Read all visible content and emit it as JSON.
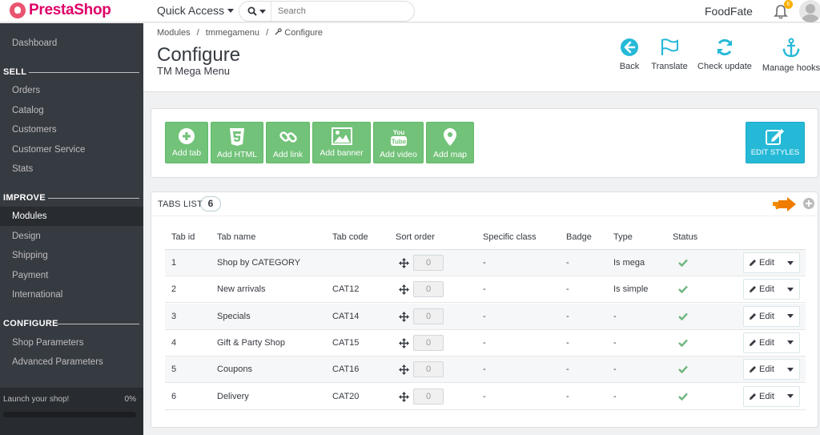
{
  "header": {
    "logo_text": "PrestaShop",
    "quick_access": "Quick Access",
    "search_placeholder": "Search",
    "shop_name": "FoodFate",
    "notification_count": "6"
  },
  "sidebar": {
    "items": [
      {
        "label": "Dashboard"
      },
      {
        "label": "Orders"
      },
      {
        "label": "Catalog"
      },
      {
        "label": "Customers"
      },
      {
        "label": "Customer Service"
      },
      {
        "label": "Stats"
      },
      {
        "label": "Modules"
      },
      {
        "label": "Design"
      },
      {
        "label": "Shipping"
      },
      {
        "label": "Payment"
      },
      {
        "label": "International"
      },
      {
        "label": "Shop Parameters"
      },
      {
        "label": "Advanced Parameters"
      }
    ],
    "sections": {
      "sell": "SELL",
      "improve": "IMPROVE",
      "configure": "CONFIGURE"
    },
    "launch_text": "Launch your shop!",
    "launch_progress": "0%"
  },
  "page": {
    "breadcrumb": {
      "b1": "Modules",
      "b2": "tmmegamenu",
      "b3": "Configure"
    },
    "title": "Configure",
    "subtitle": "TM Mega Menu",
    "toolbar": {
      "back": "Back",
      "translate": "Translate",
      "check_update": "Check update",
      "manage_hooks": "Manage hooks"
    }
  },
  "actions": {
    "add_tab": "Add tab",
    "add_html": "Add HTML",
    "add_link": "Add link",
    "add_banner": "Add banner",
    "add_video": "Add video",
    "add_map": "Add map",
    "edit_styles": "EDIT STYLES"
  },
  "tabs_list": {
    "title": "TABS LIST",
    "count": "6",
    "columns": {
      "id": "Tab id",
      "name": "Tab name",
      "code": "Tab code",
      "sort": "Sort order",
      "cls": "Specific class",
      "badge": "Badge",
      "type": "Type",
      "status": "Status"
    },
    "edit_label": "Edit",
    "rows": [
      {
        "id": "1",
        "name": "Shop by CATEGORY",
        "code": "",
        "sort": "0",
        "cls": "-",
        "badge": "-",
        "type": "Is mega"
      },
      {
        "id": "2",
        "name": "New arrivals",
        "code": "CAT12",
        "sort": "0",
        "cls": "-",
        "badge": "-",
        "type": "Is simple"
      },
      {
        "id": "3",
        "name": "Specials",
        "code": "CAT14",
        "sort": "0",
        "cls": "-",
        "badge": "-",
        "type": "-"
      },
      {
        "id": "4",
        "name": "Gift & Party Shop",
        "code": "CAT15",
        "sort": "0",
        "cls": "-",
        "badge": "-",
        "type": "-"
      },
      {
        "id": "5",
        "name": "Coupons",
        "code": "CAT16",
        "sort": "0",
        "cls": "-",
        "badge": "-",
        "type": "-"
      },
      {
        "id": "6",
        "name": "Delivery",
        "code": "CAT20",
        "sort": "0",
        "cls": "-",
        "badge": "-",
        "type": "-"
      }
    ]
  },
  "colors": {
    "brand": "#df0067",
    "sidebar": "#363a41",
    "accent": "#25b9d7",
    "success": "#72c279",
    "status_ok": "#70b580"
  },
  "icons": {
    "toolbar": [
      "back-icon",
      "translate-icon",
      "check-update-icon",
      "manage-hooks-icon"
    ],
    "actions": [
      "add-tab-icon",
      "html5-icon",
      "link-icon",
      "banner-icon",
      "youtube-icon",
      "map-marker-icon",
      "edit-styles-icon"
    ]
  }
}
